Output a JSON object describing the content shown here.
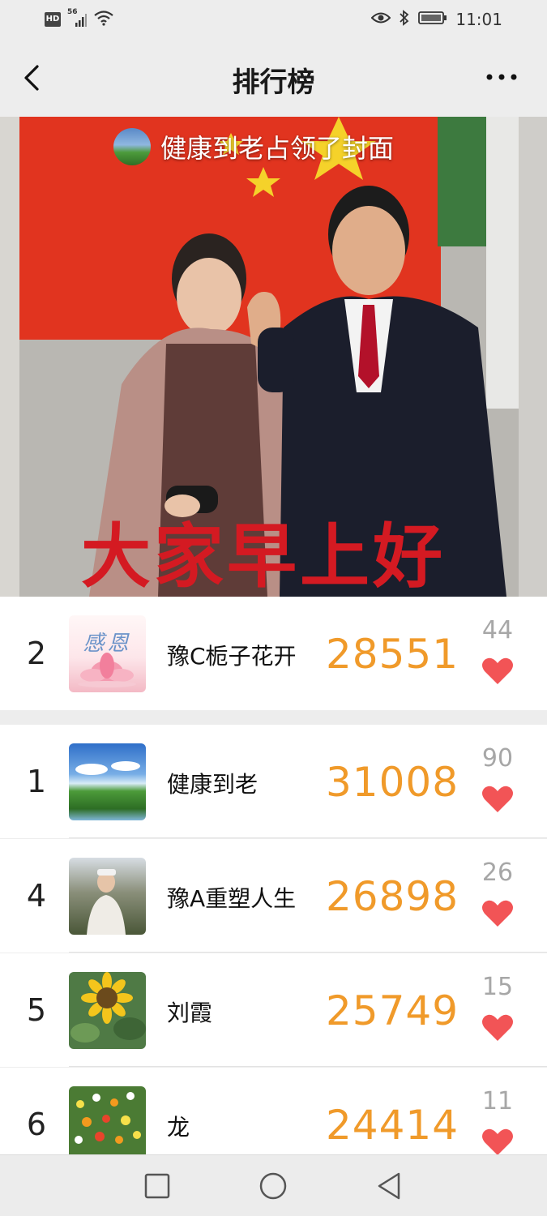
{
  "status_bar": {
    "left_badge": "HD",
    "signal_label": "56",
    "time": "11:01"
  },
  "nav": {
    "title": "排行榜"
  },
  "cover": {
    "caption": "健康到老占领了封面",
    "overlay_text": "大家早上好"
  },
  "my_rank": {
    "rank": "2",
    "avatar_text": "感恩",
    "name": "豫C栀子花开",
    "steps": "28551",
    "likes": "44"
  },
  "leaderboard": [
    {
      "rank": "1",
      "name": "健康到老",
      "steps": "31008",
      "likes": "90"
    },
    {
      "rank": "4",
      "name": "豫A重塑人生",
      "steps": "26898",
      "likes": "26"
    },
    {
      "rank": "5",
      "name": "刘霞",
      "steps": "25749",
      "likes": "15"
    },
    {
      "rank": "6",
      "name": "龙",
      "steps": "24414",
      "likes": "11"
    }
  ],
  "colors": {
    "accent_steps": "#f09a2a",
    "heart": "#f25456",
    "background": "#ededed"
  },
  "icons": {
    "back": "chevron-left-icon",
    "more": "more-dots-icon",
    "like": "heart-icon",
    "nav_square": "recent-apps-icon",
    "nav_circle": "home-icon",
    "nav_triangle": "back-triangle-icon"
  }
}
